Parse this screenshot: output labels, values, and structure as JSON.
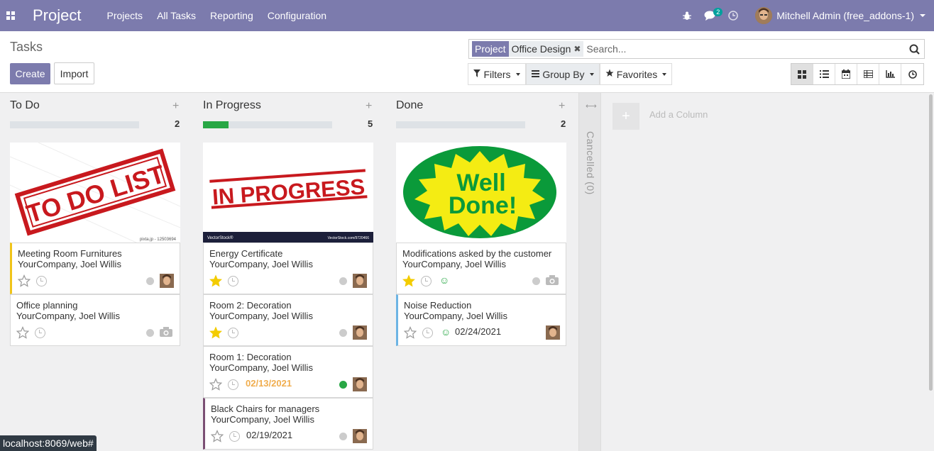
{
  "navbar": {
    "brand": "Project",
    "menu": [
      "Projects",
      "All Tasks",
      "Reporting",
      "Configuration"
    ],
    "chat_count": "2",
    "user_name": "Mitchell Admin (free_addons-1)"
  },
  "control": {
    "title": "Tasks",
    "create_label": "Create",
    "import_label": "Import",
    "facet_category": "Project",
    "facet_value": "Office Design",
    "search_placeholder": "Search...",
    "filters_label": "Filters",
    "groupby_label": "Group By",
    "favorites_label": "Favorites",
    "views": [
      "kanban",
      "list",
      "calendar",
      "pivot",
      "graph",
      "activity"
    ],
    "active_view": "kanban"
  },
  "columns": {
    "todo": {
      "title": "To Do",
      "count": "2",
      "progress": 0,
      "cover_text": "TO DO LIST",
      "cover_caption": "pixta.jp - 12503694",
      "cards": [
        {
          "name": "Meeting Room Furnitures",
          "customer": "YourCompany, Joel Willis",
          "starred": false,
          "accent": "#f0c419"
        },
        {
          "name": "Office planning",
          "customer": "YourCompany, Joel Willis",
          "starred": false,
          "accent": ""
        }
      ]
    },
    "inprogress": {
      "title": "In Progress",
      "count": "5",
      "progress": 0.2,
      "cover_text": "IN PROGRESS",
      "cover_caption_left": "VectorStock®",
      "cover_caption_right": "VectorStock.com/9720466",
      "cards": [
        {
          "name": "Energy Certificate",
          "customer": "YourCompany, Joel Willis",
          "starred": true,
          "accent": ""
        },
        {
          "name": "Room 2: Decoration",
          "customer": "YourCompany, Joel Willis",
          "starred": true,
          "accent": ""
        },
        {
          "name": "Room 1: Decoration",
          "customer": "YourCompany, Joel Willis",
          "starred": false,
          "date": "02/13/2021",
          "state": "green",
          "accent": ""
        },
        {
          "name": "Black Chairs for managers",
          "customer": "YourCompany, Joel Willis",
          "starred": false,
          "date": "02/19/2021",
          "accent": "#7b4f74"
        }
      ]
    },
    "done": {
      "title": "Done",
      "count": "2",
      "progress": 0,
      "cover_line1": "Well",
      "cover_line2": "Done!",
      "cards": [
        {
          "name": "Modifications asked by the customer",
          "customer": "YourCompany, Joel Willis",
          "starred": true,
          "accent": ""
        },
        {
          "name": "Noise Reduction",
          "customer": "YourCompany, Joel Willis",
          "starred": false,
          "date": "02/24/2021",
          "accent": "#6cb4e4"
        }
      ]
    },
    "cancelled": {
      "label": "Cancelled (0)"
    }
  },
  "add_column_label": "Add a Column",
  "status_url": "localhost:8069/web#",
  "colors": {
    "brand": "#7c7bad",
    "green": "#28a745",
    "star": "#f3cc00",
    "warn": "#f0ad4e"
  }
}
